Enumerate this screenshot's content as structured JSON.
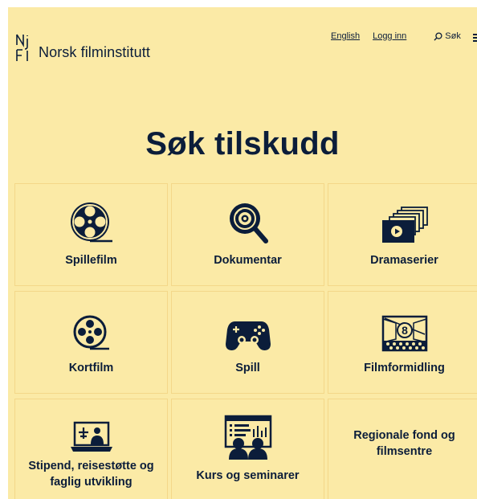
{
  "header": {
    "logo_text": "Norsk filminstitutt",
    "links": [
      "English",
      "Logg inn"
    ],
    "search_label": "Søk"
  },
  "main": {
    "title": "Søk tilskudd",
    "cards": [
      {
        "label": "Spillefilm",
        "icon": "film-reel-icon"
      },
      {
        "label": "Dokumentar",
        "icon": "magnifier-target-icon"
      },
      {
        "label": "Dramaserier",
        "icon": "stacked-video-icon"
      },
      {
        "label": "Kortfilm",
        "icon": "small-film-reel-icon"
      },
      {
        "label": "Spill",
        "icon": "gamepad-icon"
      },
      {
        "label": "Filmformidling",
        "icon": "cinema-screen-icon"
      },
      {
        "label": "Stipend, reisestøtte og faglig utvikling",
        "icon": "laptop-travel-icon"
      },
      {
        "label": "Kurs og seminarer",
        "icon": "audience-presentation-icon"
      },
      {
        "label": "Regionale fond og filmsentre",
        "icon": ""
      }
    ]
  },
  "colors": {
    "background": "#fbeaa6",
    "text": "#0b1d3a",
    "card_border": "#f3d789"
  }
}
